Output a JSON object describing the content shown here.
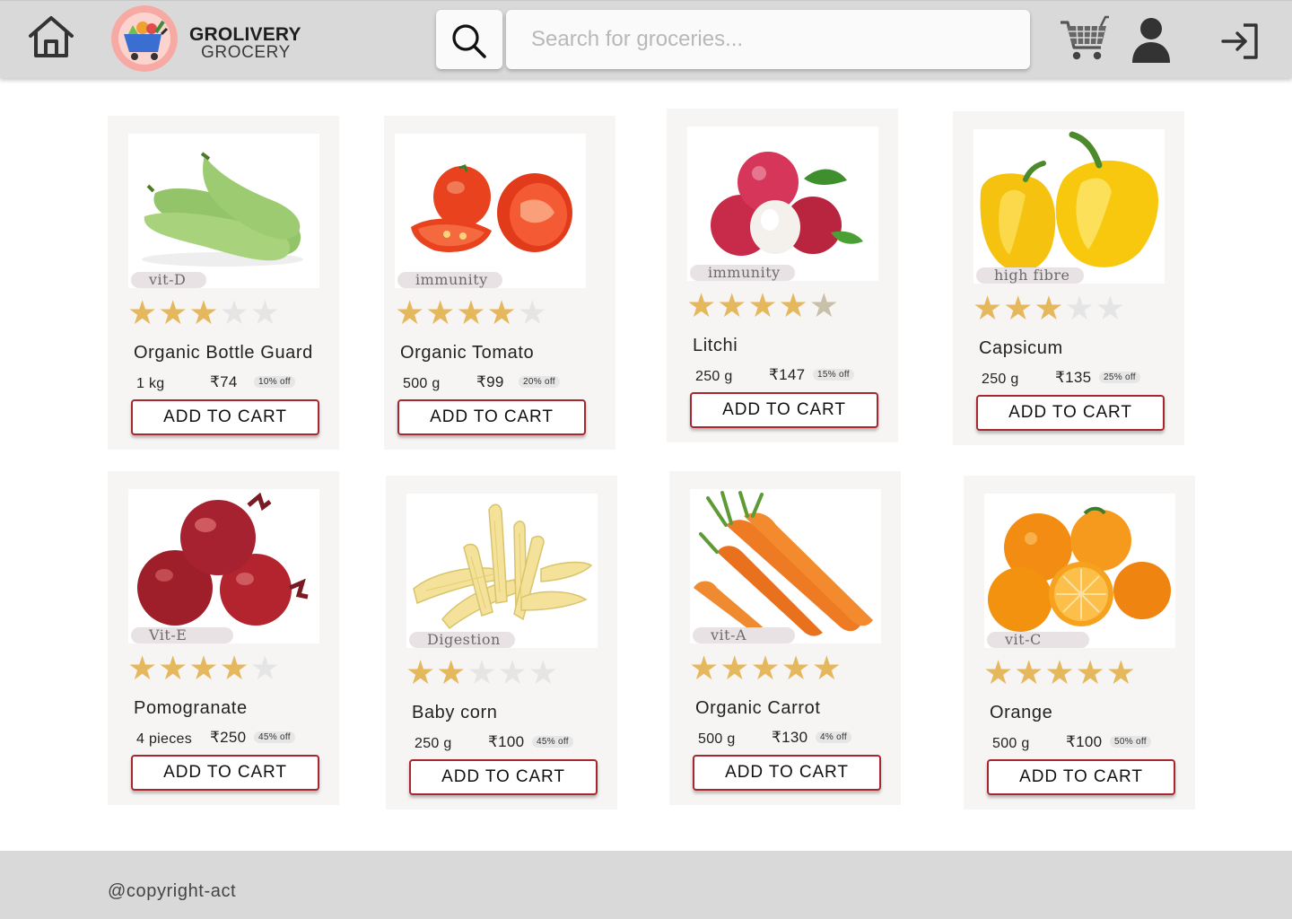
{
  "header": {
    "brand_name": "GROLIVERY",
    "brand_sub": "GROCERY",
    "search_placeholder": "Search for groceries..."
  },
  "products": [
    {
      "tag": "vit-D",
      "rating": 3,
      "name": "Organic Bottle Guard",
      "qty": "1 kg",
      "price": "₹74",
      "discount": "10% off",
      "button": "ADD TO CART"
    },
    {
      "tag": "immunity",
      "rating": 4,
      "name": "Organic Tomato",
      "qty": "500 g",
      "price": "₹99",
      "discount": "20% off",
      "button": "ADD TO CART"
    },
    {
      "tag": "immunity",
      "rating": 4.5,
      "name": "Litchi",
      "qty": "250 g",
      "price": "₹147",
      "discount": "15% off",
      "button": "ADD TO CART"
    },
    {
      "tag": "high fibre",
      "rating": 3,
      "name": "Capsicum",
      "qty": "250 g",
      "price": "₹135",
      "discount": "25% off",
      "button": "ADD TO CART"
    },
    {
      "tag": "Vit-E",
      "rating": 4,
      "name": "Pomogranate",
      "qty": "4 pieces",
      "price": "₹250",
      "discount": "45% off",
      "button": "ADD TO CART"
    },
    {
      "tag": "Digestion",
      "rating": 2,
      "name": "Baby corn",
      "qty": "250 g",
      "price": "₹100",
      "discount": "45% off",
      "button": "ADD TO CART"
    },
    {
      "tag": "vit-A",
      "rating": 5,
      "name": "Organic Carrot",
      "qty": "500 g",
      "price": "₹130",
      "discount": "4% off",
      "button": "ADD TO CART"
    },
    {
      "tag": "vit-C",
      "rating": 5,
      "name": "Orange",
      "qty": "500 g",
      "price": "₹100",
      "discount": "50% off",
      "button": "ADD TO CART"
    }
  ],
  "footer": {
    "copyright": "@copyright-act"
  },
  "icons": {
    "home": "home-icon",
    "search": "search-icon",
    "cart": "cart-icon",
    "user": "user-icon",
    "login": "login-icon"
  },
  "colors": {
    "header_bg": "#d9d9d9",
    "card_bg": "#f6f5f3",
    "star": "#e6b85e",
    "button_border": "#a8262e"
  }
}
